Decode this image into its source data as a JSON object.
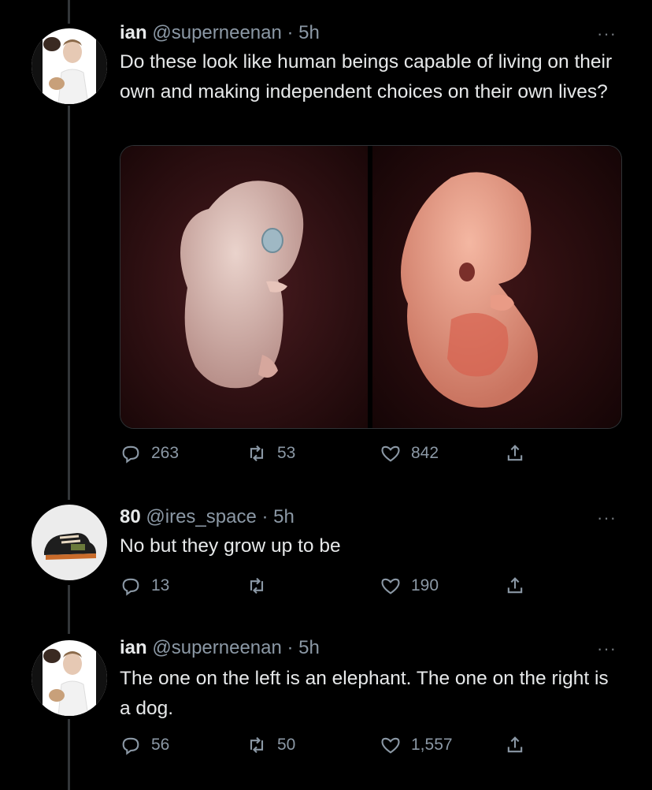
{
  "tweets": [
    {
      "name": "ian",
      "handle": "@superneenan",
      "time": "· 5h",
      "text": "Do these look like human beings capable of living on their own and making independent choices on their own lives?",
      "actions": {
        "replies": "263",
        "retweets": "53",
        "likes": "842"
      },
      "more": "···"
    },
    {
      "name": "80",
      "handle": "@ires_space",
      "time": "· 5h",
      "text": "No but they grow up to be",
      "actions": {
        "replies": "13",
        "retweets": "",
        "likes": "190"
      },
      "more": "···"
    },
    {
      "name": "ian",
      "handle": "@superneenan",
      "time": "· 5h",
      "text": "The one on the left is an elephant. The one on the right is a dog.",
      "actions": {
        "replies": "56",
        "retweets": "50",
        "likes": "1,557"
      },
      "more": "···"
    }
  ],
  "icons": {
    "reply": "reply-icon",
    "retweet": "retweet-icon",
    "like": "heart-icon",
    "share": "share-icon"
  },
  "colors": {
    "background": "#000000",
    "text": "#e7e9ea",
    "secondary": "#8b98a5",
    "thread_line": "#333639"
  }
}
